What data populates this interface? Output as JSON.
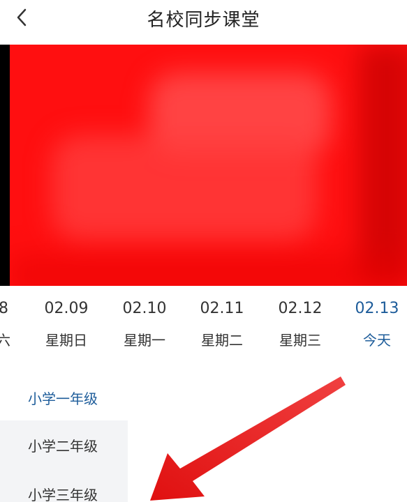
{
  "header": {
    "title": "名校同步课堂",
    "back_icon": "chevron-left-icon"
  },
  "dates": [
    {
      "date": "8",
      "weekday": "六"
    },
    {
      "date": "02.09",
      "weekday": "星期日"
    },
    {
      "date": "02.10",
      "weekday": "星期一"
    },
    {
      "date": "02.11",
      "weekday": "星期二"
    },
    {
      "date": "02.12",
      "weekday": "星期三"
    },
    {
      "date": "02.13",
      "weekday": "今天"
    }
  ],
  "grades": [
    {
      "label": "小学一年级"
    },
    {
      "label": "小学二年级"
    },
    {
      "label": "小学三年级"
    }
  ],
  "colors": {
    "accent": "#1d5c9a",
    "video": "#ff0f10",
    "annotation_arrow": "#e02020",
    "grade_inactive_bg": "#f3f4f6"
  }
}
